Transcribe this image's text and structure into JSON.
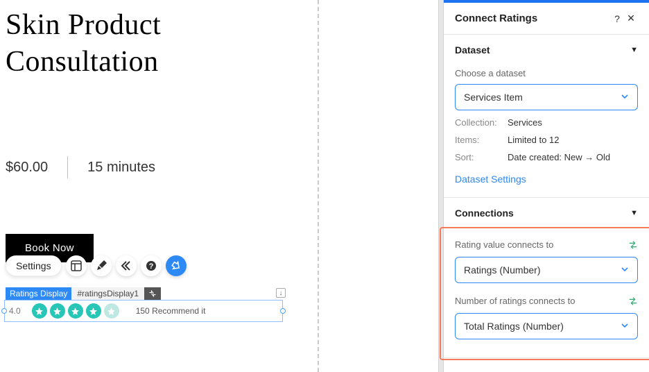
{
  "main": {
    "title_line1": "Skin Product",
    "title_line2": "Consultation",
    "price": "$60.00",
    "duration": "15 minutes",
    "book_label": "Book Now"
  },
  "toolbar": {
    "settings_label": "Settings"
  },
  "ratings_component": {
    "tag_name": "Ratings Display",
    "tag_id": "#ratingsDisplay1",
    "value": "4.0",
    "count": "150",
    "text": "Recommend it",
    "stars_filled": 4,
    "stars_total": 5
  },
  "panel": {
    "title": "Connect Ratings",
    "dataset": {
      "section_title": "Dataset",
      "choose_label": "Choose a dataset",
      "selected": "Services Item",
      "collection_k": "Collection:",
      "collection_v": "Services",
      "items_k": "Items:",
      "items_v": "Limited to 12",
      "sort_k": "Sort:",
      "sort_v": "Date created: New → Old",
      "settings_link": "Dataset Settings"
    },
    "connections": {
      "section_title": "Connections",
      "rating_value_label": "Rating value connects to",
      "rating_value_selected": "Ratings (Number)",
      "num_ratings_label": "Number of ratings connects to",
      "num_ratings_selected": "Total Ratings (Number)"
    }
  }
}
